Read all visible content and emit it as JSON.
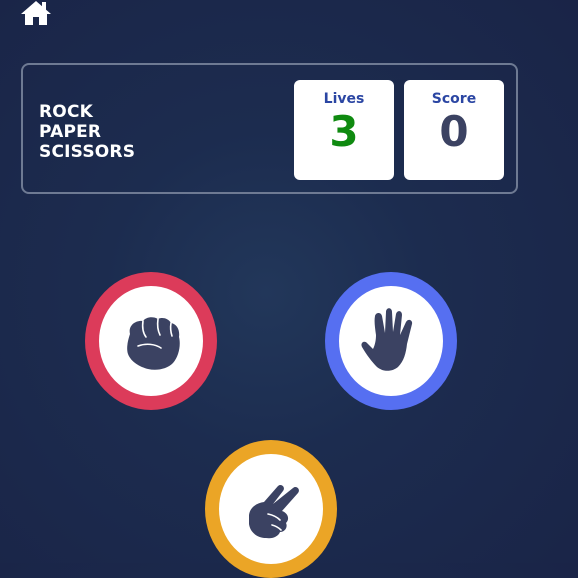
{
  "title_lines": [
    "ROCK",
    "PAPER",
    "SCISSORS"
  ],
  "stats": {
    "lives_label": "Lives",
    "lives_value": "3",
    "score_label": "Score",
    "score_value": "0"
  },
  "choices": [
    {
      "name": "rock",
      "icon": "fist-icon",
      "ring_color": "#dc3b5a"
    },
    {
      "name": "paper",
      "icon": "open-hand-icon",
      "ring_color": "#566ff1"
    },
    {
      "name": "scissors",
      "icon": "two-fingers-icon",
      "ring_color": "#eba526"
    }
  ],
  "colors": {
    "background": "#1c2a4d",
    "lives_value": "#0f8a10",
    "score_value": "#3b4262",
    "stat_label": "#2b46a3",
    "hand_icon": "#3b4262"
  }
}
